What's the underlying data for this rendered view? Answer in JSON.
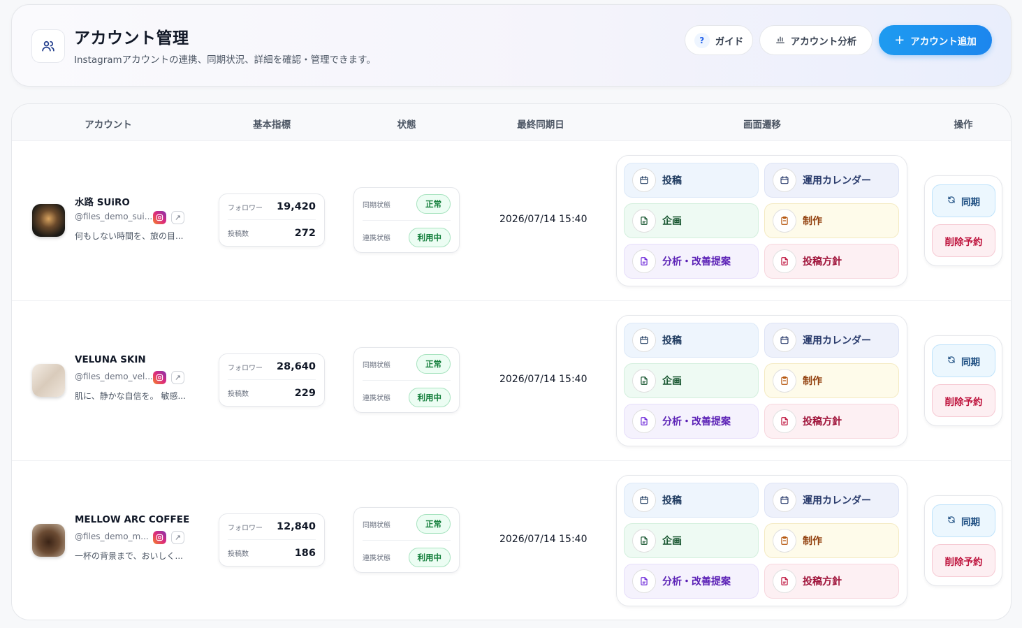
{
  "header": {
    "title": "アカウント管理",
    "subtitle": "Instagramアカウントの連携、同期状況、詳細を確認・管理できます。",
    "guide_label": "ガイド",
    "analytics_label": "アカウント分析",
    "add_label": "アカウント追加"
  },
  "table": {
    "columns": {
      "account": "アカウント",
      "metrics": "基本指標",
      "status": "状態",
      "last_sync": "最終同期日",
      "nav": "画面遷移",
      "ops": "操作"
    },
    "labels": {
      "followers": "フォロワー",
      "posts": "投稿数",
      "sync_state": "同期状態",
      "link_state": "連携状態"
    },
    "nav_labels": {
      "post": "投稿",
      "calendar": "運用カレンダー",
      "plan": "企画",
      "production": "制作",
      "analysis": "分析・改善提案",
      "policy": "投稿方針"
    },
    "op_labels": {
      "sync": "同期",
      "delete": "削除予約"
    },
    "rows": [
      {
        "name": "水路 SUiRO",
        "handle": "@files_demo_sui...",
        "description": "何もしない時間を、旅の目...",
        "followers": "19,420",
        "posts": "272",
        "sync_status": "正常",
        "link_status": "利用中",
        "last_sync": "2026/07/14 15:40"
      },
      {
        "name": "VELUNA SKIN",
        "handle": "@files_demo_vel...",
        "description": "肌に、静かな自信を。 敏感...",
        "followers": "28,640",
        "posts": "229",
        "sync_status": "正常",
        "link_status": "利用中",
        "last_sync": "2026/07/14 15:40"
      },
      {
        "name": "MELLOW ARC COFFEE",
        "handle": "@files_demo_m...",
        "description": "一杯の背景まで、おいしく...",
        "followers": "12,840",
        "posts": "186",
        "sync_status": "正常",
        "link_status": "利用中",
        "last_sync": "2026/07/14 15:40"
      }
    ]
  }
}
